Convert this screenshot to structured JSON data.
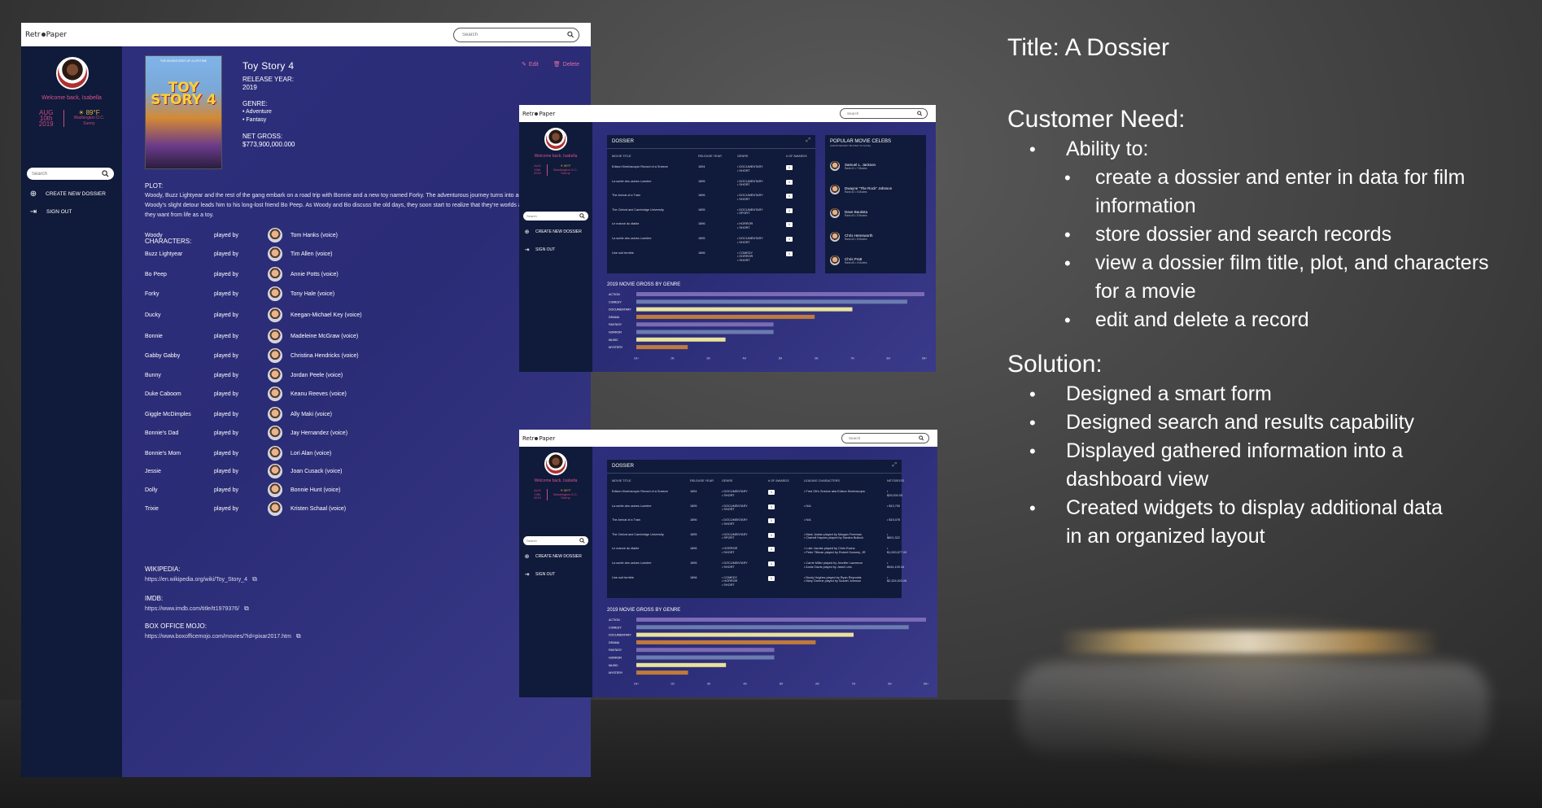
{
  "app": {
    "brand": "RetroPaper",
    "search_placeholder": "Search"
  },
  "sidebar": {
    "welcome": "Welcome back, Isabella",
    "date_month": "AUG",
    "date_day": "10th",
    "date_year": "2019",
    "temp": "89°F",
    "city": "Washington D.C.",
    "weather": "Sunny",
    "search_placeholder": "Search",
    "create_label": "CREATE NEW DOSSIER",
    "signout_label": "SIGN OUT"
  },
  "movie": {
    "poster_top": "THE ADVENTURES OF A LIFETIME",
    "poster_title": "TOY STORY 4",
    "title": "Toy Story 4",
    "edit_label": "Edit",
    "delete_label": "Delete",
    "release_label": "RELEASE YEAR:",
    "release_year": "2019",
    "genre_label": "GENRE:",
    "genres": [
      "• Adventure",
      "• Fantasy"
    ],
    "gross_label": "NET GROSS:",
    "gross": "$773,900,000.000",
    "plot_label": "PLOT:",
    "plot": "Woody, Buzz Lightyear and the rest of the gang embark on a road trip with Bonnie and a new toy named Forky. The adventurous journey turns into an unexpected reunion as Woody's slight detour leads him to his long-lost friend Bo Peep. As Woody and Bo discuss the old days, they soon start to realize that they're worlds apart when it comes to what they want from life as a toy.",
    "characters_label": "CHARACTERS:",
    "played_by": "played by",
    "characters": [
      {
        "name": "Woody",
        "actor": "Tom Hanks (voice)"
      },
      {
        "name": "Buzz Lightyear",
        "actor": "Tim Allen (voice)"
      },
      {
        "name": "Bo Peep",
        "actor": "Annie Potts (voice)"
      },
      {
        "name": "Forky",
        "actor": "Tony Hale (voice)"
      },
      {
        "name": "Ducky",
        "actor": "Keegan-Michael Key (voice)"
      },
      {
        "name": "Bonnie",
        "actor": "Madeleine McGraw (voice)"
      },
      {
        "name": "Gabby Gabby",
        "actor": "Christina Hendricks (voice)"
      },
      {
        "name": "Bunny",
        "actor": "Jordan Peele (voice)"
      },
      {
        "name": "Duke Caboom",
        "actor": "Keanu Reeves (voice)"
      },
      {
        "name": "Giggle McDimples",
        "actor": "Ally Maki (voice)"
      },
      {
        "name": "Bonnie's Dad",
        "actor": "Jay Hernandez (voice)"
      },
      {
        "name": "Bonnie's Mom",
        "actor": "Lori Alan (voice)"
      },
      {
        "name": "Jessie",
        "actor": "Joan Cusack (voice)"
      },
      {
        "name": "Dolly",
        "actor": "Bonnie Hunt (voice)"
      },
      {
        "name": "Trixie",
        "actor": "Kristen Schaal (voice)"
      }
    ],
    "links": [
      {
        "label": "WIKIPEDIA:",
        "url": "https://en.wikipedia.org/wiki/Toy_Story_4"
      },
      {
        "label": "IMDB:",
        "url": "https://www.imdb.com/title/tt1979376/"
      },
      {
        "label": "BOX OFFICE MOJO:",
        "url": "https://www.boxofficemojo.com/movies/?id=pixar2017.htm"
      }
    ]
  },
  "dash": {
    "dossier_title": "DOSSIER",
    "headers": [
      "MOVIE TITLE",
      "RELEASE YEAR",
      "GENRE",
      "# OF AWARDS"
    ],
    "headers2": [
      "MOVIE TITLE",
      "RELEASE YEAR",
      "GENRE",
      "# OF AWARDS",
      "LEADING CHARACTERS",
      "NETGROSS"
    ],
    "rows": [
      {
        "title": "Edison Kinetoscopic Record of a Sneeze",
        "year": "1894",
        "genre": "• DOCUMENTARY\n• SHORT",
        "awards": "1",
        "chars": "• Fred Ott's Sneeze aka Edison Kinetoscopic",
        "gross": "• $29,000.05"
      },
      {
        "title": "La sortie des usines Lumière",
        "year": "1895",
        "genre": "• DOCUMENTARY\n• SHORT",
        "awards": "1",
        "chars": "• N/A",
        "gross": "• $10,700"
      },
      {
        "title": "The Arrival of a Train",
        "year": "1896",
        "genre": "• DOCUMENTARY\n• SHORT",
        "awards": "1",
        "chars": "• N/A",
        "gross": "• $15,078"
      },
      {
        "title": "The Oxford and Cambridge University",
        "year": "1895",
        "genre": "• DOCUMENTARY\n• SPORT",
        "awards": "1",
        "chars": "• Mark Jordan played by Morgan Freeman\n• Clarbell Haynes played by Sandra Bullock",
        "gross": "• $601,322"
      },
      {
        "title": "Le manoir du diable",
        "year": "1896",
        "genre": "• HORROR\n• SHORT",
        "awards": "1",
        "chars": "• Luke Jacobs played by Chris Evans\n• Peter Tillman played by Robert Downey, JR",
        "gross": "• $1,000,677.00"
      },
      {
        "title": "La sortie des usines Lumière",
        "year": "1895",
        "genre": "• DOCUMENTARY\n• SHORT",
        "awards": "1",
        "chars": "• Carrie Miller played by Jennifer Lawrence\n• Annie Davis played by Jared Leto",
        "gross": "• $944,109.34"
      },
      {
        "title": "Une nuit terrible",
        "year": "1896",
        "genre": "• COMEDY\n• HORROR\n• SHORT",
        "awards": "1",
        "chars": "• Brody Hughes played by Ryan Reynolds\n• Mary Greene played by Scarlet Johnson",
        "gross": "• $2,324,923.06"
      }
    ],
    "celebs_title": "POPULAR MOVIE CELEBS",
    "celebs_sub": "(FROM RECENT MOVIES TO DATE)",
    "celebs": [
      {
        "name": "Samuel L. Jackson",
        "rank": "Rank #1 • 7 Movies"
      },
      {
        "name": "Dwayne \"The Rock\" Johnson",
        "rank": "Rank #2 • 6 Movies"
      },
      {
        "name": "Dave Bautista",
        "rank": "Rank #3 • 5 Movies"
      },
      {
        "name": "Chris Hemsworth",
        "rank": "Rank #4 • 5 Movies"
      },
      {
        "name": "Chris Pratt",
        "rank": "Rank #5 • 4 Movies"
      }
    ]
  },
  "chart_data": {
    "type": "bar",
    "title": "2019 MOVIE GROSS BY GENRE",
    "orientation": "horizontal",
    "categories": [
      "ACTION",
      "COMEDY",
      "DOCUMENTARY",
      "DRAMA",
      "FANTASY",
      "HORROR",
      "MUSIC",
      "MYSTERY"
    ],
    "values": [
      8.4,
      7.9,
      6.3,
      5.2,
      4.0,
      4.0,
      2.6,
      1.5
    ],
    "colors": [
      "#7b6bb4",
      "#6c7bb0",
      "#e8e29c",
      "#c07a3c",
      "#7b6bb4",
      "#6c7bb0",
      "#e8e29c",
      "#c07a3c"
    ],
    "x_ticks": [
      "1M+",
      "2M",
      "3M",
      "4M",
      "5M",
      "6M",
      "7M",
      "8M",
      "9M+"
    ],
    "xlim": [
      0,
      8.4
    ]
  },
  "right": {
    "title": "Title: A Dossier",
    "need_heading": "Customer Need:",
    "need_ability": "Ability to:",
    "need_items": [
      "create a dossier and enter in data for film information",
      "store dossier and search records",
      "view a dossier film title, plot, and characters for a movie",
      "edit and delete a record"
    ],
    "solution_heading": "Solution:",
    "solution_items": [
      "Designed a smart form",
      "Designed search and results capability",
      "Displayed gathered information into a dashboard view",
      "Created widgets to display additional data in an organized layout"
    ]
  },
  "colors": {
    "brand_pink": "#d6548d",
    "sidebar": "#101a3a",
    "main_bg": "#2e2f7e"
  }
}
